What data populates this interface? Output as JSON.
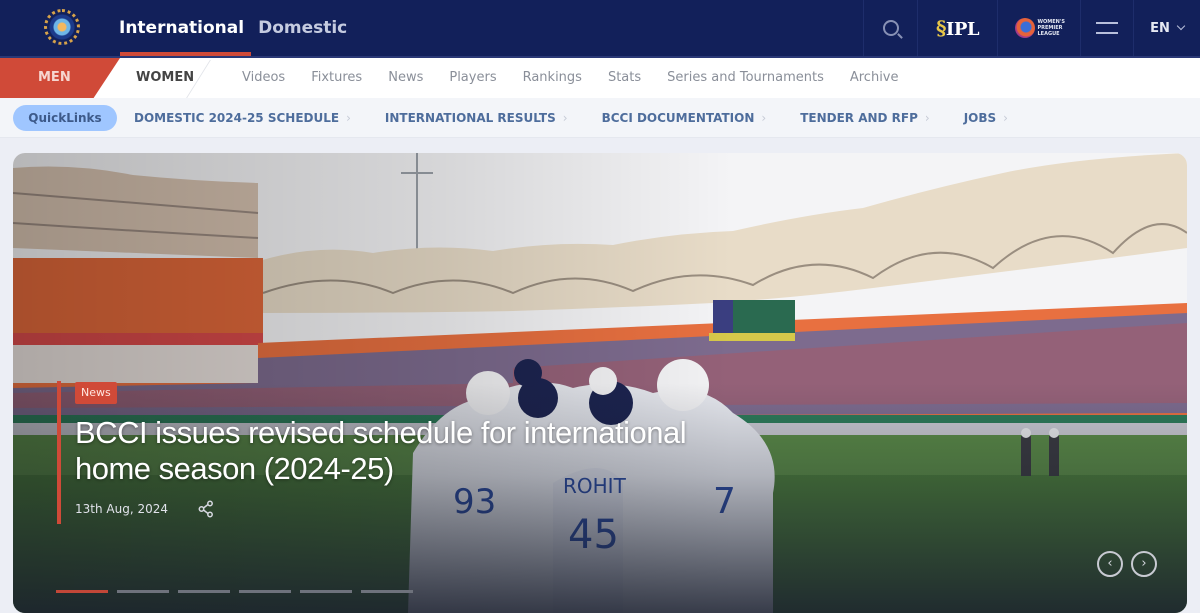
{
  "header": {
    "logo_alt": "BCCI",
    "tabs": [
      {
        "label": "International",
        "active": true
      },
      {
        "label": "Domestic",
        "active": false
      }
    ],
    "tools": {
      "search_icon": "search-icon",
      "ipl_logo_text": "IPL",
      "wpl_logo_text": "WOMEN'S PREMIER LEAGUE",
      "menu_icon": "hamburger-icon",
      "language": "EN"
    }
  },
  "subnav": {
    "genders": [
      {
        "label": "MEN",
        "active": true
      },
      {
        "label": "WOMEN",
        "active": false
      }
    ],
    "links": [
      "Videos",
      "Fixtures",
      "News",
      "Players",
      "Rankings",
      "Stats",
      "Series and Tournaments",
      "Archive"
    ]
  },
  "quicklinks": {
    "button_label": "QuickLinks",
    "items": [
      "DOMESTIC 2024-25 SCHEDULE",
      "INTERNATIONAL RESULTS",
      "BCCI DOCUMENTATION",
      "TENDER AND RFP",
      "JOBS"
    ],
    "arrow": "›"
  },
  "hero": {
    "badge": "News",
    "headline": "BCCI issues revised schedule for international home season (2024-25)",
    "date": "13th Aug, 2024",
    "prev_label": "‹",
    "next_label": "›",
    "slide_count": 6,
    "active_slide": 1,
    "colors": {
      "accent": "#d04a38",
      "navy": "#12205a",
      "quicklink_pill": "#9fc6ff"
    }
  }
}
